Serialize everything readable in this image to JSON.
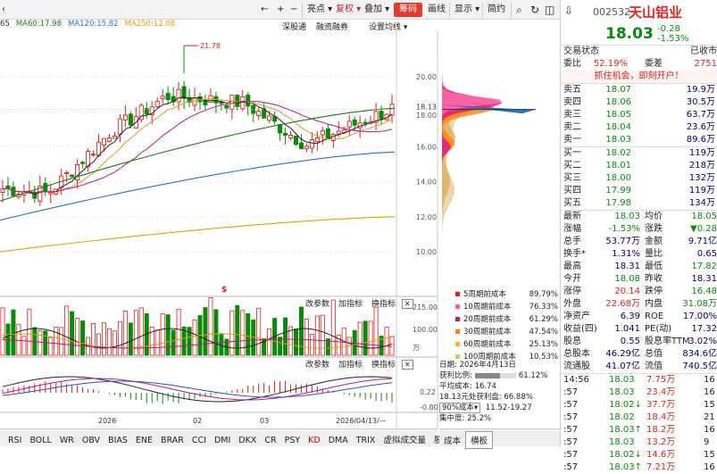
{
  "toolbar": {
    "left_arrow": "‹",
    "nav_back": "←",
    "nav_plus": "+",
    "nav_minus": "−",
    "highlight_label": "亮点",
    "restore_label": "复权",
    "overlay_label": "叠加",
    "chips_label": "筹码",
    "draw_label": "画线",
    "display_label": "显示",
    "brief_label": "简约",
    "search_glyph": "⌕",
    "refresh_glyph": "↻",
    "split_glyph": "◫",
    "pin_glyph": "⇩"
  },
  "ma_legend": [
    {
      "text": "65",
      "color": "#333333"
    },
    {
      "text": "MA60:17.98",
      "color": "#1a7a1a"
    },
    {
      "text": "MA120:15.82",
      "color": "#1f77c9"
    },
    {
      "text": "MA250:12.08",
      "color": "#e0a000"
    }
  ],
  "sub_links": {
    "shenzhen": "深股通",
    "margin": "融资融券",
    "settings": "设置均线"
  },
  "price_axis": [
    "20.00",
    "18.13",
    "18.00",
    "16.00",
    "14.00",
    "12.00",
    "10.00"
  ],
  "peak_label": "21.78",
  "vol_axis": [
    "215.00",
    "100.00",
    "万"
  ],
  "macd_axis": [
    "0.22",
    "-0.80"
  ],
  "panel_header": {
    "modify_params": "改参数",
    "add_indicator": "加指标",
    "switch_indicator": "换指标"
  },
  "date_axis": [
    "2026",
    "02",
    "03",
    "2026/04/13/—"
  ],
  "marker_dollar": "$",
  "bottom_tabs": [
    "RSI",
    "BOLL",
    "WR",
    "OBV",
    "BIAS",
    "ENE",
    "BRAR",
    "CCI",
    "DMI",
    "DKX",
    "CR",
    "PSY",
    "KD",
    "DMA",
    "TRIX",
    "虚拟成交量",
    "股东"
  ],
  "bottom_active": "KD",
  "cost_legend": [
    {
      "label": "5周期前成本",
      "value": "89.79%",
      "color": "#e0201c"
    },
    {
      "label": "10周期前成本",
      "value": "76.33%",
      "color": "#ff5aa8"
    },
    {
      "label": "20周期前成本",
      "value": "61.29%",
      "color": "#c8147a"
    },
    {
      "label": "30周期前成本",
      "value": "47.54%",
      "color": "#ff7a00"
    },
    {
      "label": "60周期前成本",
      "value": "25.13%",
      "color": "#ffb020"
    },
    {
      "label": "100周期前成本",
      "value": "10.53%",
      "color": "#e0c060"
    }
  ],
  "cost_info": {
    "date": "日期: 2026年4月13日",
    "profit_label": "获利比例:",
    "profit_value": "61.12%",
    "profit_ratio": 0.6112,
    "avg_cost": "平均成本: 16.74",
    "at_price": "18.13元处获利盘: 66.88%",
    "cost_90": "90%成本",
    "cost_90_range": "11.52-19.27",
    "concentration": "集中度: 25.2%"
  },
  "cost_tabs": [
    "成本",
    "横板"
  ],
  "cost_tab_active": "横板",
  "quote": {
    "code": "002532",
    "name": "天山铝业",
    "price": "18.03",
    "change": "-0.28",
    "change_pct": "-1.53%",
    "status_label": "交易状态",
    "status_value": "已收市",
    "commit_ratio_label": "委比",
    "commit_ratio": "52.19%",
    "commit_diff_label": "委差",
    "commit_diff": "2751",
    "promo": "抓住机会，即刻开户！"
  },
  "asks": [
    {
      "label": "卖五",
      "price": "18.07",
      "vol": "19.9万"
    },
    {
      "label": "卖四",
      "price": "18.06",
      "vol": "30.5万"
    },
    {
      "label": "卖三",
      "price": "18.05",
      "vol": "63.7万"
    },
    {
      "label": "卖二",
      "price": "18.04",
      "vol": "23.6万"
    },
    {
      "label": "卖一",
      "price": "18.03",
      "vol": "89.6万"
    }
  ],
  "bids": [
    {
      "label": "买一",
      "price": "18.02",
      "vol": "119万"
    },
    {
      "label": "买二",
      "price": "18.01",
      "vol": "218万"
    },
    {
      "label": "买三",
      "price": "18.00",
      "vol": "132万"
    },
    {
      "label": "买四",
      "price": "17.99",
      "vol": "119万"
    },
    {
      "label": "买五",
      "price": "17.98",
      "vol": "134万"
    }
  ],
  "stats": [
    {
      "k1": "最新",
      "v1": "18.03",
      "c1": "green",
      "k2": "均价",
      "v2": "18.05",
      "c2": "green"
    },
    {
      "k1": "涨幅",
      "v1": "-1.53%",
      "c1": "green",
      "k2": "涨跌",
      "v2": "▼0.28",
      "c2": "green"
    },
    {
      "k1": "总手",
      "v1": "53.77万",
      "c1": "navy",
      "k2": "金额",
      "v2": "9.71亿",
      "c2": "navy"
    },
    {
      "k1": "换手*",
      "v1": "1.31%",
      "c1": "navy",
      "k2": "量比",
      "v2": "0.65",
      "c2": "navy"
    },
    {
      "k1": "最高",
      "v1": "18.31",
      "c1": "navy",
      "k2": "最低",
      "v2": "17.82",
      "c2": "green"
    },
    {
      "k1": "今开",
      "v1": "18.08",
      "c1": "green",
      "k2": "昨收",
      "v2": "18.31",
      "c2": "navy"
    },
    {
      "k1": "涨停",
      "v1": "20.14",
      "c1": "red-t",
      "k2": "跌停",
      "v2": "16.48",
      "c2": "green"
    },
    {
      "k1": "外盘",
      "v1": "22.68万",
      "c1": "red-t",
      "k2": "内盘",
      "v2": "31.08万",
      "c2": "green"
    },
    {
      "k1": "净资产",
      "v1": "6.39",
      "c1": "navy",
      "k2": "ROE",
      "v2": "17.00%",
      "c2": "navy"
    },
    {
      "k1": "收益(四)",
      "v1": "1.041",
      "c1": "navy",
      "k2": "PE(动)",
      "v2": "17.32",
      "c2": "navy"
    },
    {
      "k1": "股息",
      "v1": "0.55",
      "c1": "navy",
      "k2": "股息率TTM",
      "v2": "3.02%",
      "c2": "navy"
    },
    {
      "k1": "总股本",
      "v1": "46.29亿",
      "c1": "navy",
      "k2": "总值",
      "v2": "834.6亿",
      "c2": "navy"
    },
    {
      "k1": "流通股",
      "v1": "41.07亿",
      "c1": "navy",
      "k2": "流值",
      "v2": "740.5亿",
      "c2": "navy"
    }
  ],
  "ticks": [
    {
      "time": "14:56",
      "price": "18.03",
      "vol": "7.75万",
      "extra": "16"
    },
    {
      "time": ":57",
      "price": "18.03",
      "vol": "23.4万",
      "extra": "16"
    },
    {
      "time": ":57",
      "price": "18.02↓",
      "vol": "37.7万",
      "extra": "15"
    },
    {
      "time": ":57",
      "price": "18.02",
      "vol": "18.4万",
      "extra": "21"
    },
    {
      "time": ":57",
      "price": "18.03↑",
      "vol": "18.2万",
      "extra": "16"
    },
    {
      "time": ":57",
      "price": "18.03",
      "vol": "13.2万",
      "extra": "9"
    },
    {
      "time": ":57",
      "price": "18.02↓",
      "vol": "14.6万",
      "extra": "15"
    },
    {
      "time": ":57",
      "price": "18.03↑",
      "vol": "7.21万",
      "extra": "16"
    }
  ],
  "colors": {
    "up": "#e0201c",
    "down": "#0a8a0a",
    "accent": "#e23a2f"
  }
}
